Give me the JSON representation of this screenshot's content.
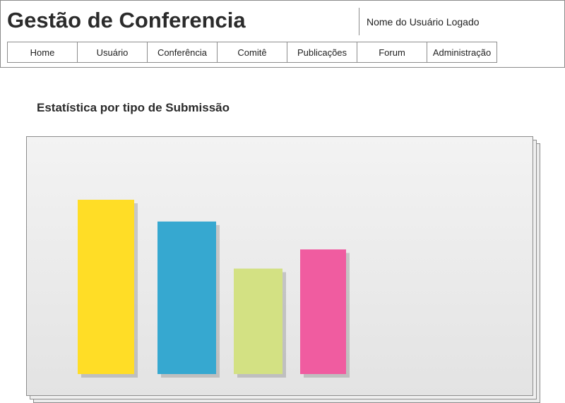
{
  "app": {
    "title": "Gestão de Conferencia",
    "user_name": "Nome do Usuário Logado"
  },
  "nav": {
    "items": [
      {
        "label": "Home"
      },
      {
        "label": "Usuário"
      },
      {
        "label": "Conferência"
      },
      {
        "label": "Comitê"
      },
      {
        "label": "Publicações"
      },
      {
        "label": "Forum"
      },
      {
        "label": "Administração"
      }
    ]
  },
  "section": {
    "title": "Estatística por tipo de Submissão"
  },
  "chart_data": {
    "type": "bar",
    "values": [
      100,
      87.5,
      60.5,
      71.5
    ],
    "colors": [
      "#ffdd26",
      "#36a8d0",
      "#d3e183",
      "#f05ca0"
    ],
    "ylim": [
      0,
      100
    ],
    "grid": false
  }
}
